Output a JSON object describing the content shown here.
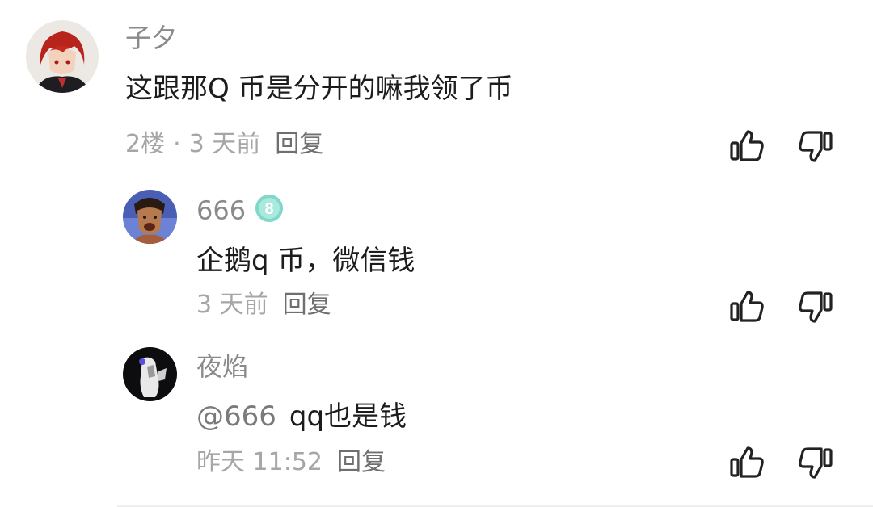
{
  "comments": [
    {
      "username": "子夕",
      "text": "这跟那Q 币是分开的嘛我领了币",
      "floor": "2楼",
      "separator": "·",
      "time": "3 天前",
      "reply_label": "回复"
    },
    {
      "username": "666",
      "level_badge": "8",
      "text": "企鹅q 币，微信钱",
      "time": "3 天前",
      "reply_label": "回复"
    },
    {
      "username": "夜焰",
      "mention": "@666",
      "text": "qq也是钱",
      "time": "昨天 11:52",
      "reply_label": "回复"
    }
  ],
  "icons": {
    "like": "thumbs-up-icon",
    "dislike": "thumbs-down-icon"
  },
  "colors": {
    "username": "#8a8a8a",
    "meta": "#a6a6a6",
    "reply": "#6f6f6f",
    "badge": "#7fd8c8"
  }
}
